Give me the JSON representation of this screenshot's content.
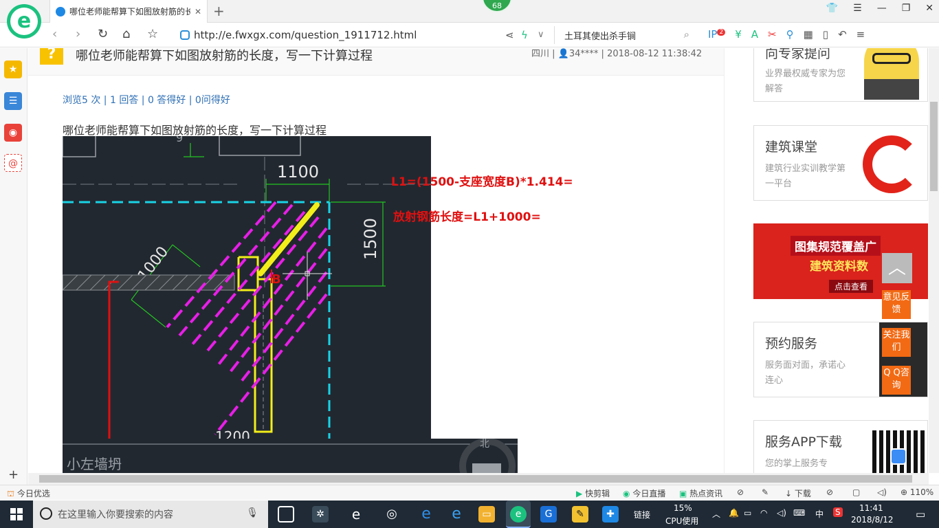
{
  "browser": {
    "tab_title": "哪位老师能帮算下如图放射筋的长度，写一下计算过程",
    "badge_count": "68",
    "url": "http://e.fwxgx.com/question_1911712.html",
    "search_text": "土耳其使出杀手锏",
    "ext_badge": "2"
  },
  "question": {
    "title": "哪位老师能帮算下如图放射筋的长度，写一下计算过程",
    "region": "四川",
    "user": "34****",
    "datetime": "2018-08-12 11:38:42",
    "stats": "浏览5 次 | 1 回答 | 0 答得好 | 0问得好",
    "body": "哪位老师能帮算下如图放射筋的长度，写一下计算过程"
  },
  "drawing": {
    "dim_top": "1100",
    "dim_right": "1500",
    "dim_left": "1000",
    "dim_bottom": "1200",
    "label_b": "B",
    "note1": "L1=(1500-支座宽度B)*1.414=",
    "note2": "放射钢筋长度=L1+1000=",
    "north": "北",
    "bottom_text": "小左墙坍",
    "top_label": "9"
  },
  "right_cards": [
    {
      "title": "向专家提问",
      "desc": "业界最权威专家为您解答"
    },
    {
      "title": "建筑课堂",
      "desc": "建筑行业实训教学第一平台"
    },
    {
      "title": "预约服务",
      "desc": "服务面对面，承诺心连心"
    },
    {
      "title": "服务APP下载",
      "desc": "您的掌上服务专"
    }
  ],
  "promo": {
    "line1": "图集规范覆盖广",
    "line2": "建筑资料数",
    "line3": "点击查看"
  },
  "float_buttons": {
    "feedback": "意见反馈",
    "follow": "关注我们",
    "qq": "Q Q咨询"
  },
  "statusbar": {
    "left": "今日优选",
    "quick_cut": "快剪辑",
    "live": "今日直播",
    "news": "热点资讯",
    "download": "下载",
    "zoom": "110%"
  },
  "taskbar": {
    "search_placeholder": "在这里输入你要搜索的内容",
    "link": "链接",
    "cpu_percent": "15%",
    "cpu_label": "CPU使用",
    "ime": "中",
    "time": "11:41",
    "date": "2018/8/12"
  },
  "colors": {
    "accent_green": "#1bc27f",
    "cad_bg": "#222830",
    "note_red": "#e01010",
    "float_orange": "#f26a14"
  }
}
